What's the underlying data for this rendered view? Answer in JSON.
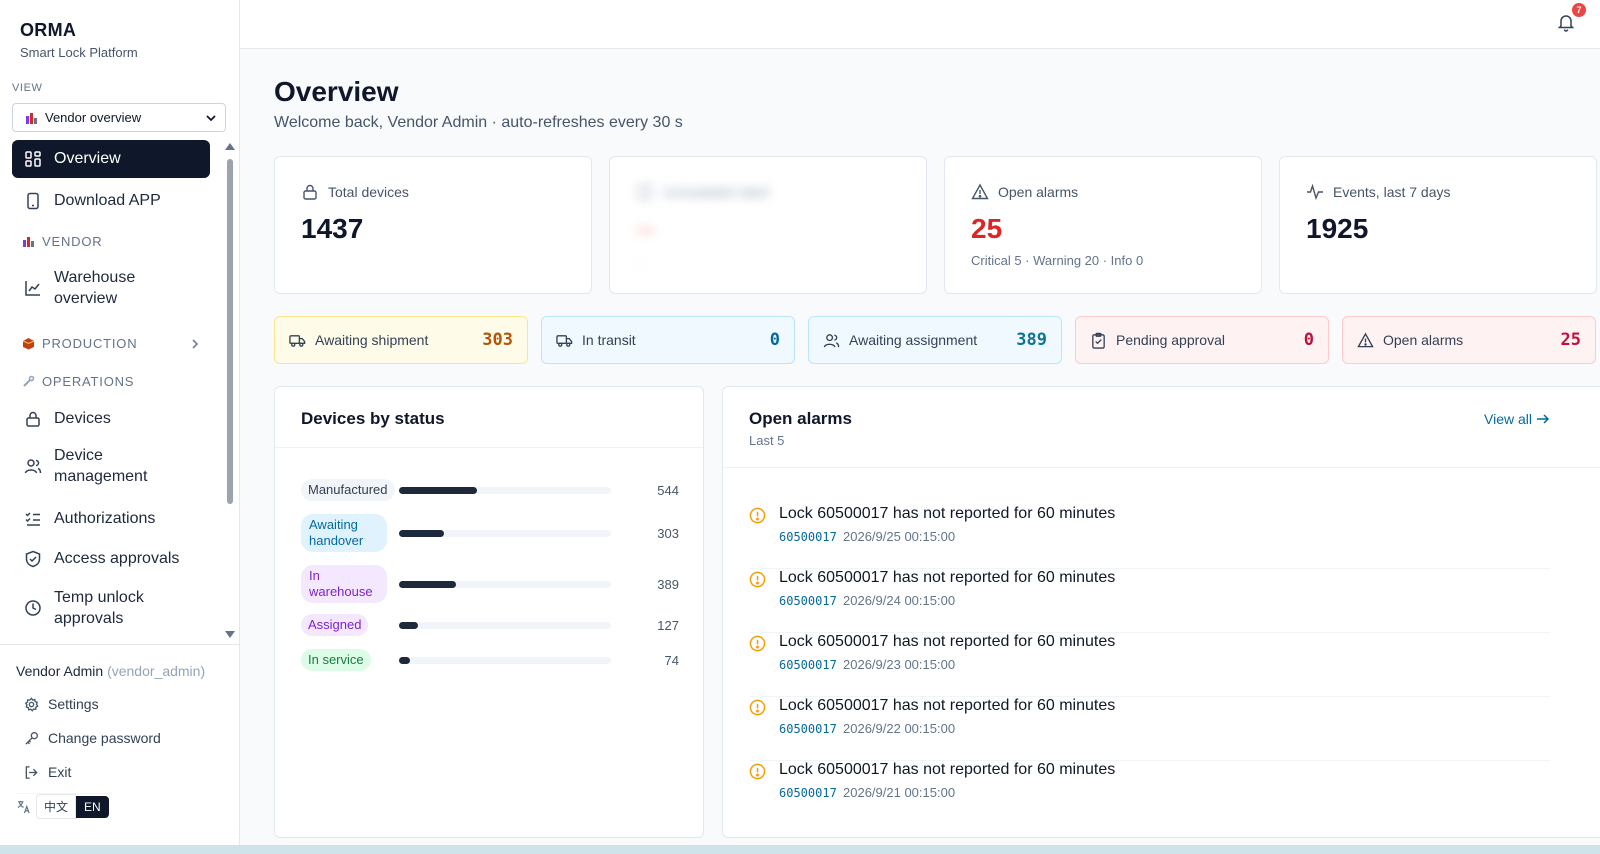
{
  "brand": {
    "name": "ORMA",
    "subtitle": "Smart Lock Platform"
  },
  "view": {
    "label": "VIEW",
    "selected": "Vendor overview"
  },
  "nav": {
    "overview": "Overview",
    "download_app": "Download APP",
    "section_vendor": "VENDOR",
    "warehouse_overview": "Warehouse overview",
    "section_production": "PRODUCTION",
    "section_operations": "OPERATIONS",
    "devices": "Devices",
    "device_management": "Device management",
    "authorizations": "Authorizations",
    "access_approvals": "Access approvals",
    "temp_unlock_approvals": "Temp unlock approvals"
  },
  "user": {
    "display_name": "Vendor Admin",
    "username": "(vendor_admin)"
  },
  "footer_links": {
    "settings": "Settings",
    "change_password": "Change password",
    "exit": "Exit"
  },
  "language": {
    "zh": "中文",
    "en": "EN",
    "active": "EN"
  },
  "topbar": {
    "notification_count": "7"
  },
  "page": {
    "title": "Overview",
    "subtitle": "Welcome back, Vendor Admin · auto-refreshes every 30 s"
  },
  "kpis": {
    "total_devices": {
      "label": "Total devices",
      "value": "1437"
    },
    "blurred": {
      "label": "Unreadable label",
      "value": "--",
      "note": "--"
    },
    "open_alarms": {
      "label": "Open alarms",
      "value": "25",
      "note": "Critical 5 · Warning 20 · Info 0"
    },
    "events": {
      "label": "Events, last 7 days",
      "value": "1925"
    }
  },
  "pipeline": [
    {
      "label": "Awaiting shipment",
      "value": "303"
    },
    {
      "label": "In transit",
      "value": "0"
    },
    {
      "label": "Awaiting assignment",
      "value": "389"
    },
    {
      "label": "Pending approval",
      "value": "0"
    },
    {
      "label": "Open alarms",
      "value": "25"
    }
  ],
  "status_panel": {
    "title": "Devices by status",
    "rows": [
      {
        "label": "Manufactured",
        "value": "544",
        "fraction": 0.37
      },
      {
        "label": "Awaiting handover",
        "value": "303",
        "fraction": 0.21
      },
      {
        "label": "In warehouse",
        "value": "389",
        "fraction": 0.27
      },
      {
        "label": "Assigned",
        "value": "127",
        "fraction": 0.09
      },
      {
        "label": "In service",
        "value": "74",
        "fraction": 0.05
      }
    ]
  },
  "alarms_panel": {
    "title": "Open alarms",
    "subtitle": "Last 5",
    "view_all": "View all",
    "items": [
      {
        "message": "Lock 60500017 has not reported for 60 minutes",
        "code": "60500017",
        "time": "2026/9/25 00:15:00"
      },
      {
        "message": "Lock 60500017 has not reported for 60 minutes",
        "code": "60500017",
        "time": "2026/9/24 00:15:00"
      },
      {
        "message": "Lock 60500017 has not reported for 60 minutes",
        "code": "60500017",
        "time": "2026/9/23 00:15:00"
      },
      {
        "message": "Lock 60500017 has not reported for 60 minutes",
        "code": "60500017",
        "time": "2026/9/22 00:15:00"
      },
      {
        "message": "Lock 60500017 has not reported for 60 minutes",
        "code": "60500017",
        "time": "2026/9/21 00:15:00"
      }
    ]
  },
  "colors": {
    "primary_dark": "#0f172a",
    "alarm_red": "#dc2626",
    "link_blue": "#0369a1",
    "warning_amber": "#f59e0b"
  },
  "icons": {
    "view_select": "warehouse-icon",
    "overview": "grid-icon",
    "download_app": "phone-icon",
    "warehouse": "chart-icon",
    "devices": "lock-icon",
    "device_management": "users-icon",
    "authorizations": "checklist-icon",
    "access_approvals": "shield-icon",
    "temp_unlock": "clock-icon",
    "notification": "bell-icon",
    "alarm_item": "alert-circle-icon"
  }
}
